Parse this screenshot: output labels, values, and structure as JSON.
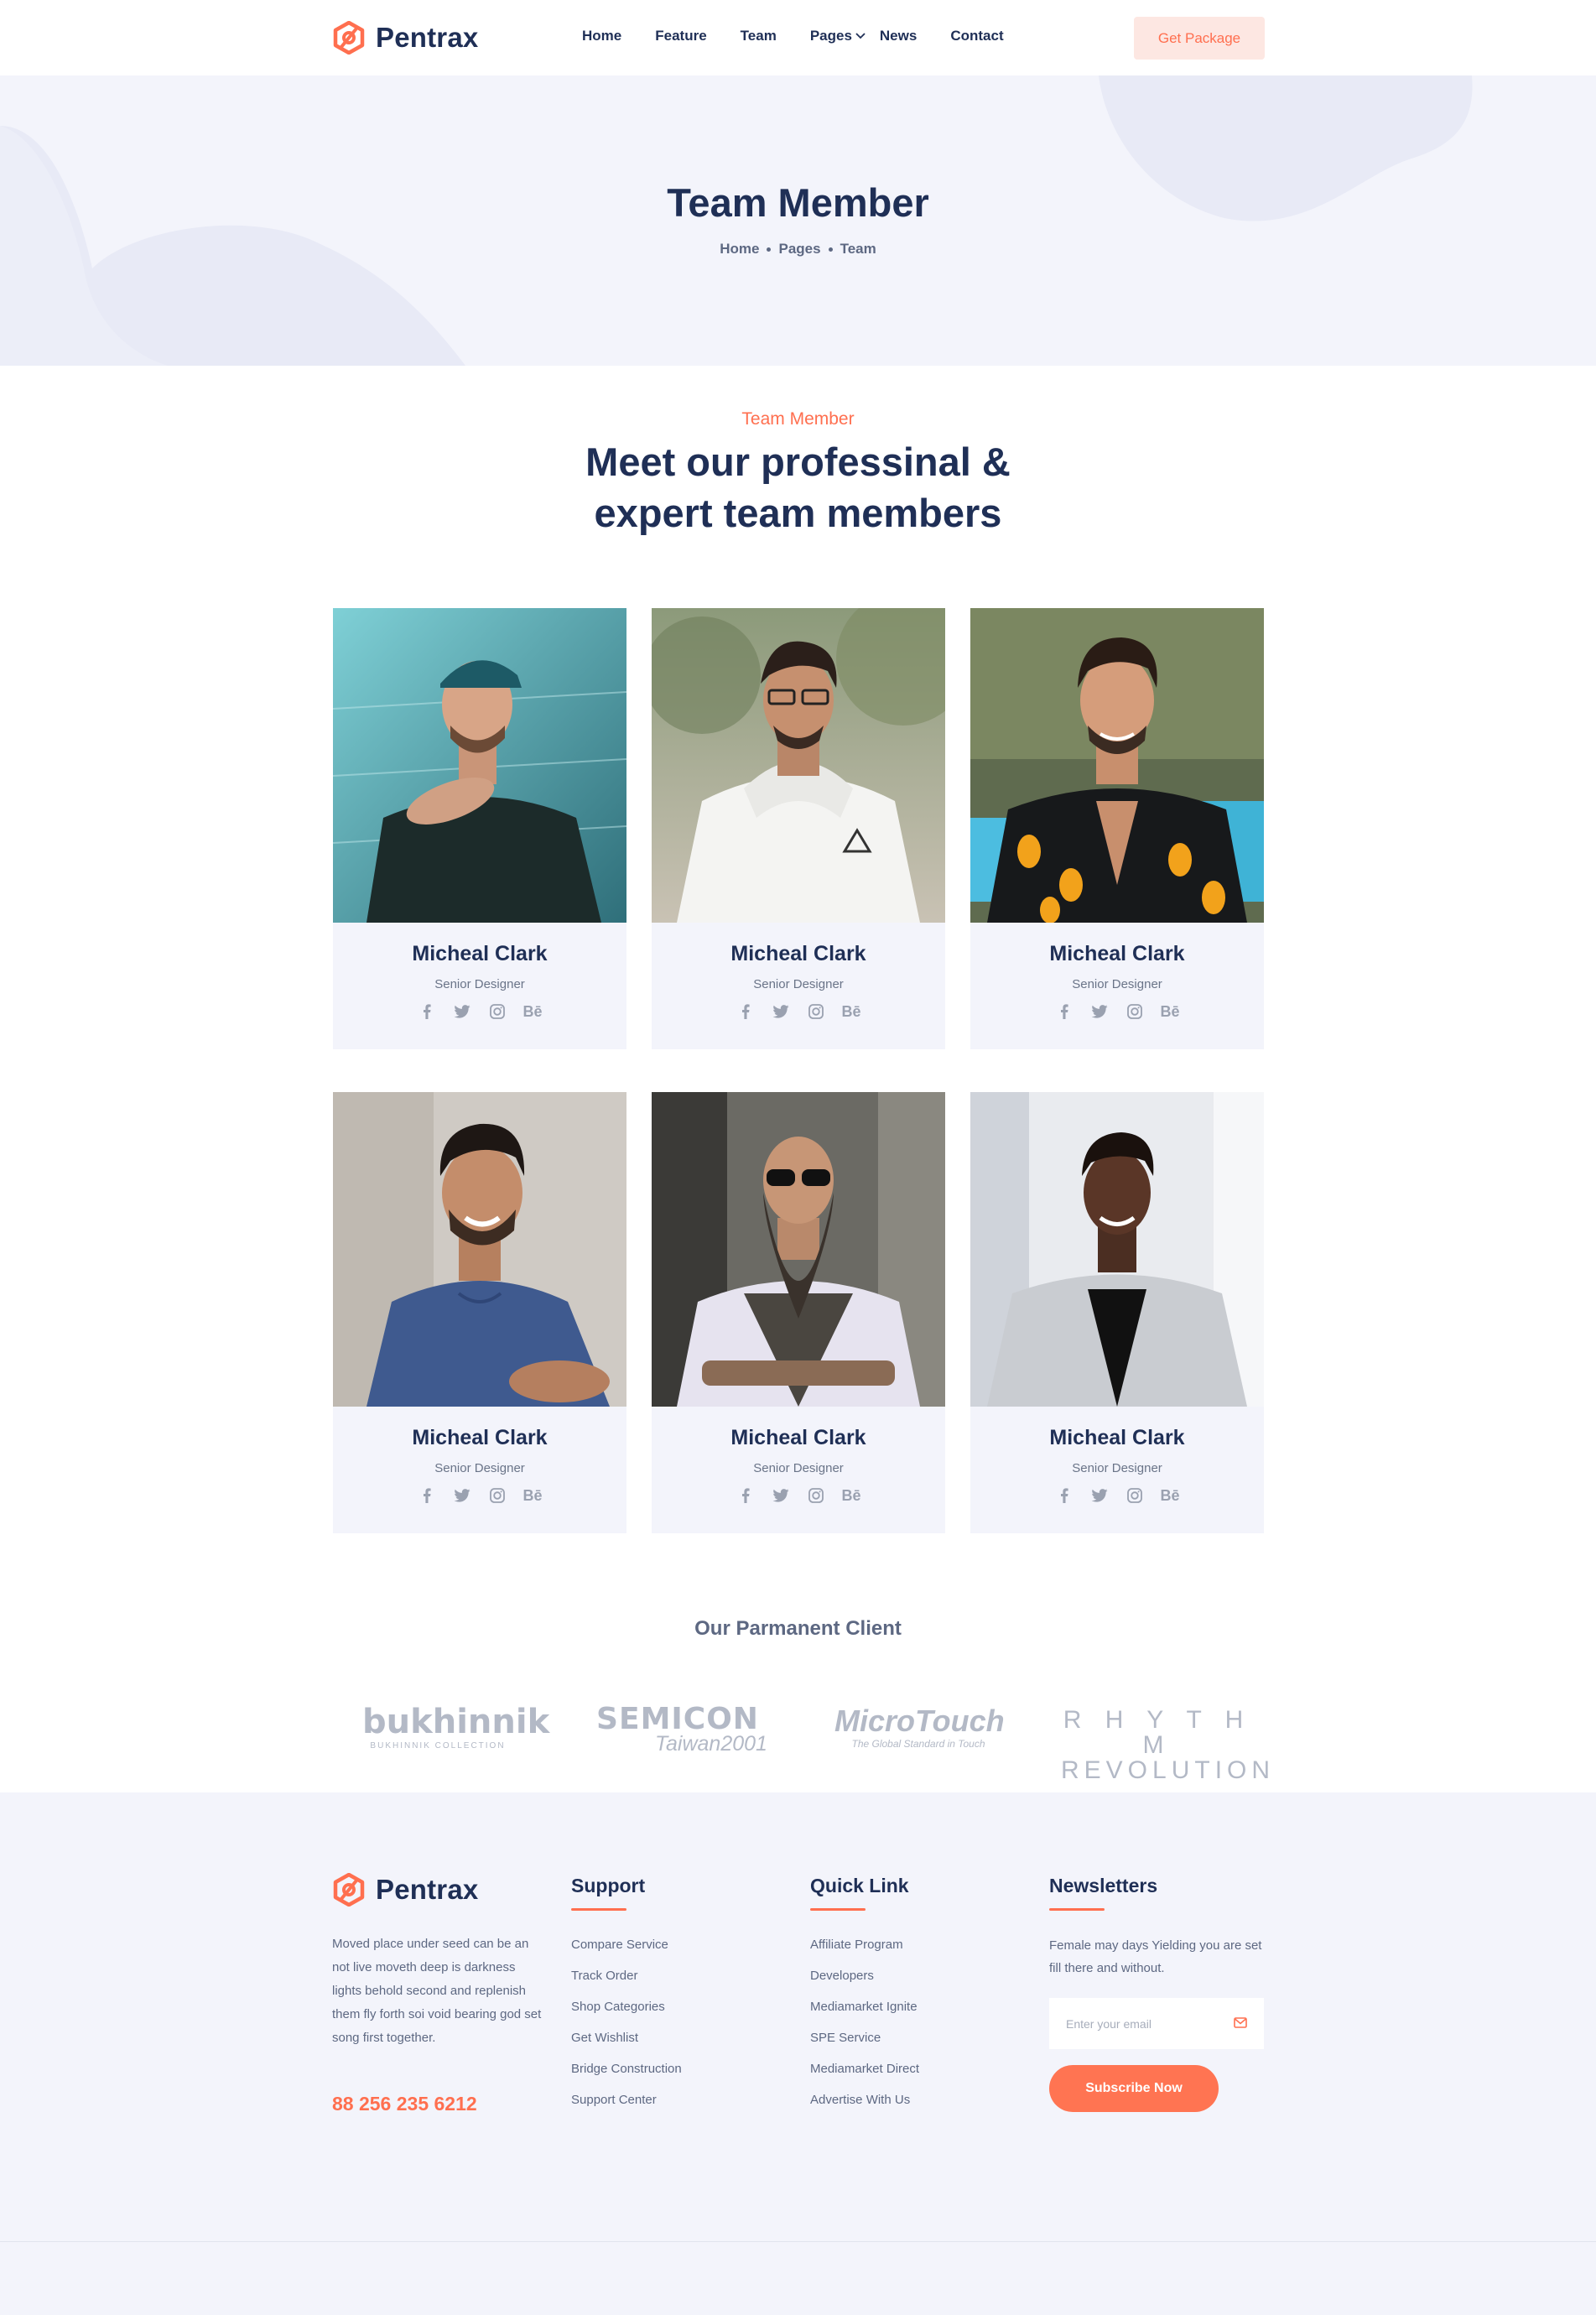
{
  "brand": {
    "name": "Pentrax",
    "accent": "#ff6f4f",
    "navy": "#1f2f56"
  },
  "nav": {
    "items": [
      "Home",
      "Feature",
      "Team",
      "Pages",
      "News",
      "Contact"
    ],
    "cta": "Get Package"
  },
  "hero": {
    "title": "Team Member",
    "breadcrumb": [
      "Home",
      "Pages",
      "Team"
    ]
  },
  "team": {
    "eyebrow": "Team Member",
    "title_line1": "Meet our professinal &",
    "title_line2": "expert team members",
    "members": [
      {
        "name": "Micheal Clark",
        "role": "Senior Designer"
      },
      {
        "name": "Micheal Clark",
        "role": "Senior Designer"
      },
      {
        "name": "Micheal Clark",
        "role": "Senior Designer"
      },
      {
        "name": "Micheal Clark",
        "role": "Senior Designer"
      },
      {
        "name": "Micheal Clark",
        "role": "Senior Designer"
      },
      {
        "name": "Micheal Clark",
        "role": "Senior Designer"
      }
    ],
    "social_icons": [
      "facebook-icon",
      "twitter-icon",
      "instagram-icon",
      "behance-icon"
    ],
    "behance_glyph": "Bē"
  },
  "clients": {
    "title": "Our Parmanent Client",
    "logos": [
      {
        "main": "bukhinnik",
        "sub": "BUKHINNIK COLLECTION"
      },
      {
        "main": "SEMICON",
        "sub": "Taiwan2001"
      },
      {
        "main": "MicroTouch",
        "sub": "The Global Standard in Touch"
      },
      {
        "main": "R H Y T H M",
        "sub": "REVOLUTION"
      }
    ]
  },
  "footer": {
    "about": "Moved place under seed can be an not live moveth deep is darkness lights behold second and replenish them fly forth soi void bearing god set song first together.",
    "phone": "88 256 235 6212",
    "support": {
      "title": "Support",
      "links": [
        "Compare Service",
        "Track Order",
        "Shop Categories",
        "Get Wishlist",
        "Bridge Construction",
        "Support Center"
      ]
    },
    "quick": {
      "title": "Quick Link",
      "links": [
        "Affiliate Program",
        "Developers",
        "Mediamarket Ignite",
        "SPE Service",
        "Mediamarket Direct",
        "Advertise With Us"
      ]
    },
    "newsletter": {
      "title": "Newsletters",
      "text": "Female may days Yielding you are set fill there and without.",
      "placeholder": "Enter your email",
      "button": "Subscribe Now"
    }
  }
}
